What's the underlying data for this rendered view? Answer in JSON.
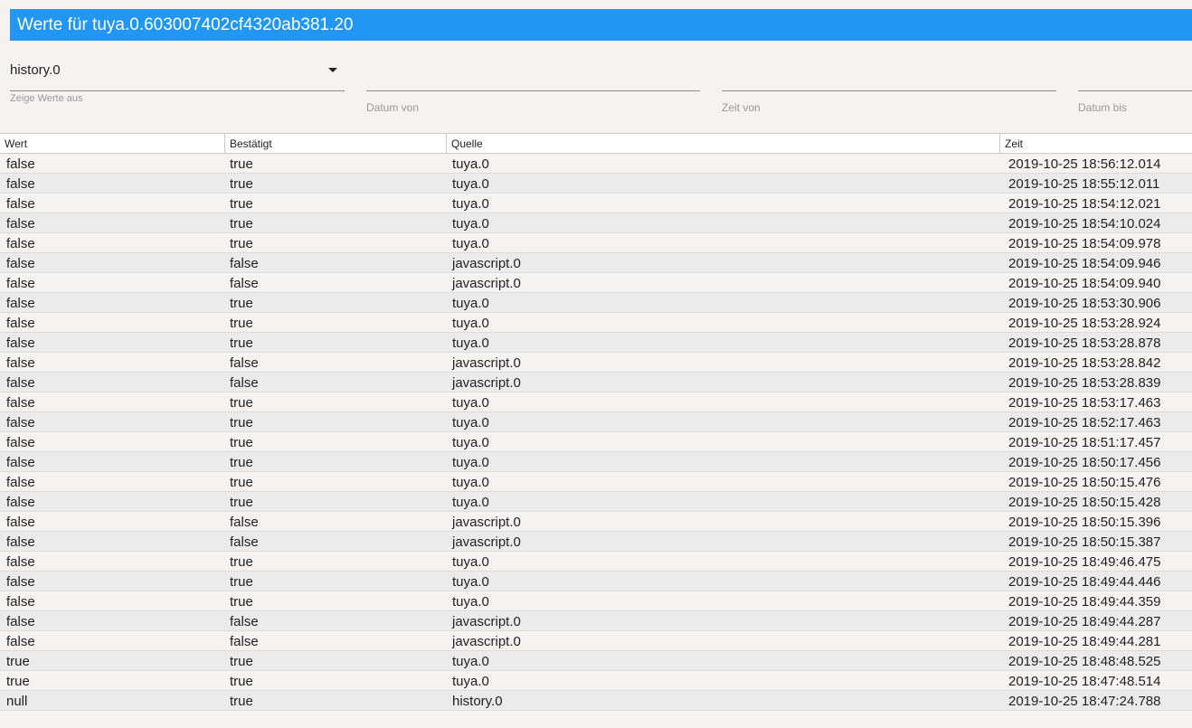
{
  "window": {
    "title": "Werte für tuya.0.603007402cf4320ab381.20"
  },
  "filters": {
    "instance": {
      "value": "history.0",
      "helper": "Zeige Werte aus"
    },
    "date_from": {
      "label": "Datum von",
      "value": ""
    },
    "time_from": {
      "label": "Zeit von",
      "value": ""
    },
    "date_to": {
      "label": "Datum bis",
      "value": ""
    }
  },
  "table": {
    "columns": [
      "Wert",
      "Bestätigt",
      "Quelle",
      "Zeit"
    ],
    "rows": [
      [
        "false",
        "true",
        "tuya.0",
        "2019-10-25 18:56:12.014"
      ],
      [
        "false",
        "true",
        "tuya.0",
        "2019-10-25 18:55:12.011"
      ],
      [
        "false",
        "true",
        "tuya.0",
        "2019-10-25 18:54:12.021"
      ],
      [
        "false",
        "true",
        "tuya.0",
        "2019-10-25 18:54:10.024"
      ],
      [
        "false",
        "true",
        "tuya.0",
        "2019-10-25 18:54:09.978"
      ],
      [
        "false",
        "false",
        "javascript.0",
        "2019-10-25 18:54:09.946"
      ],
      [
        "false",
        "false",
        "javascript.0",
        "2019-10-25 18:54:09.940"
      ],
      [
        "false",
        "true",
        "tuya.0",
        "2019-10-25 18:53:30.906"
      ],
      [
        "false",
        "true",
        "tuya.0",
        "2019-10-25 18:53:28.924"
      ],
      [
        "false",
        "true",
        "tuya.0",
        "2019-10-25 18:53:28.878"
      ],
      [
        "false",
        "false",
        "javascript.0",
        "2019-10-25 18:53:28.842"
      ],
      [
        "false",
        "false",
        "javascript.0",
        "2019-10-25 18:53:28.839"
      ],
      [
        "false",
        "true",
        "tuya.0",
        "2019-10-25 18:53:17.463"
      ],
      [
        "false",
        "true",
        "tuya.0",
        "2019-10-25 18:52:17.463"
      ],
      [
        "false",
        "true",
        "tuya.0",
        "2019-10-25 18:51:17.457"
      ],
      [
        "false",
        "true",
        "tuya.0",
        "2019-10-25 18:50:17.456"
      ],
      [
        "false",
        "true",
        "tuya.0",
        "2019-10-25 18:50:15.476"
      ],
      [
        "false",
        "true",
        "tuya.0",
        "2019-10-25 18:50:15.428"
      ],
      [
        "false",
        "false",
        "javascript.0",
        "2019-10-25 18:50:15.396"
      ],
      [
        "false",
        "false",
        "javascript.0",
        "2019-10-25 18:50:15.387"
      ],
      [
        "false",
        "true",
        "tuya.0",
        "2019-10-25 18:49:46.475"
      ],
      [
        "false",
        "true",
        "tuya.0",
        "2019-10-25 18:49:44.446"
      ],
      [
        "false",
        "true",
        "tuya.0",
        "2019-10-25 18:49:44.359"
      ],
      [
        "false",
        "false",
        "javascript.0",
        "2019-10-25 18:49:44.287"
      ],
      [
        "false",
        "false",
        "javascript.0",
        "2019-10-25 18:49:44.281"
      ],
      [
        "true",
        "true",
        "tuya.0",
        "2019-10-25 18:48:48.525"
      ],
      [
        "true",
        "true",
        "tuya.0",
        "2019-10-25 18:47:48.514"
      ],
      [
        "null",
        "true",
        "history.0",
        "2019-10-25 18:47:24.788"
      ]
    ]
  },
  "colors": {
    "title_bar": "#2196f3",
    "background": "#f5f2ef",
    "row_alt": "#ebebeb"
  }
}
